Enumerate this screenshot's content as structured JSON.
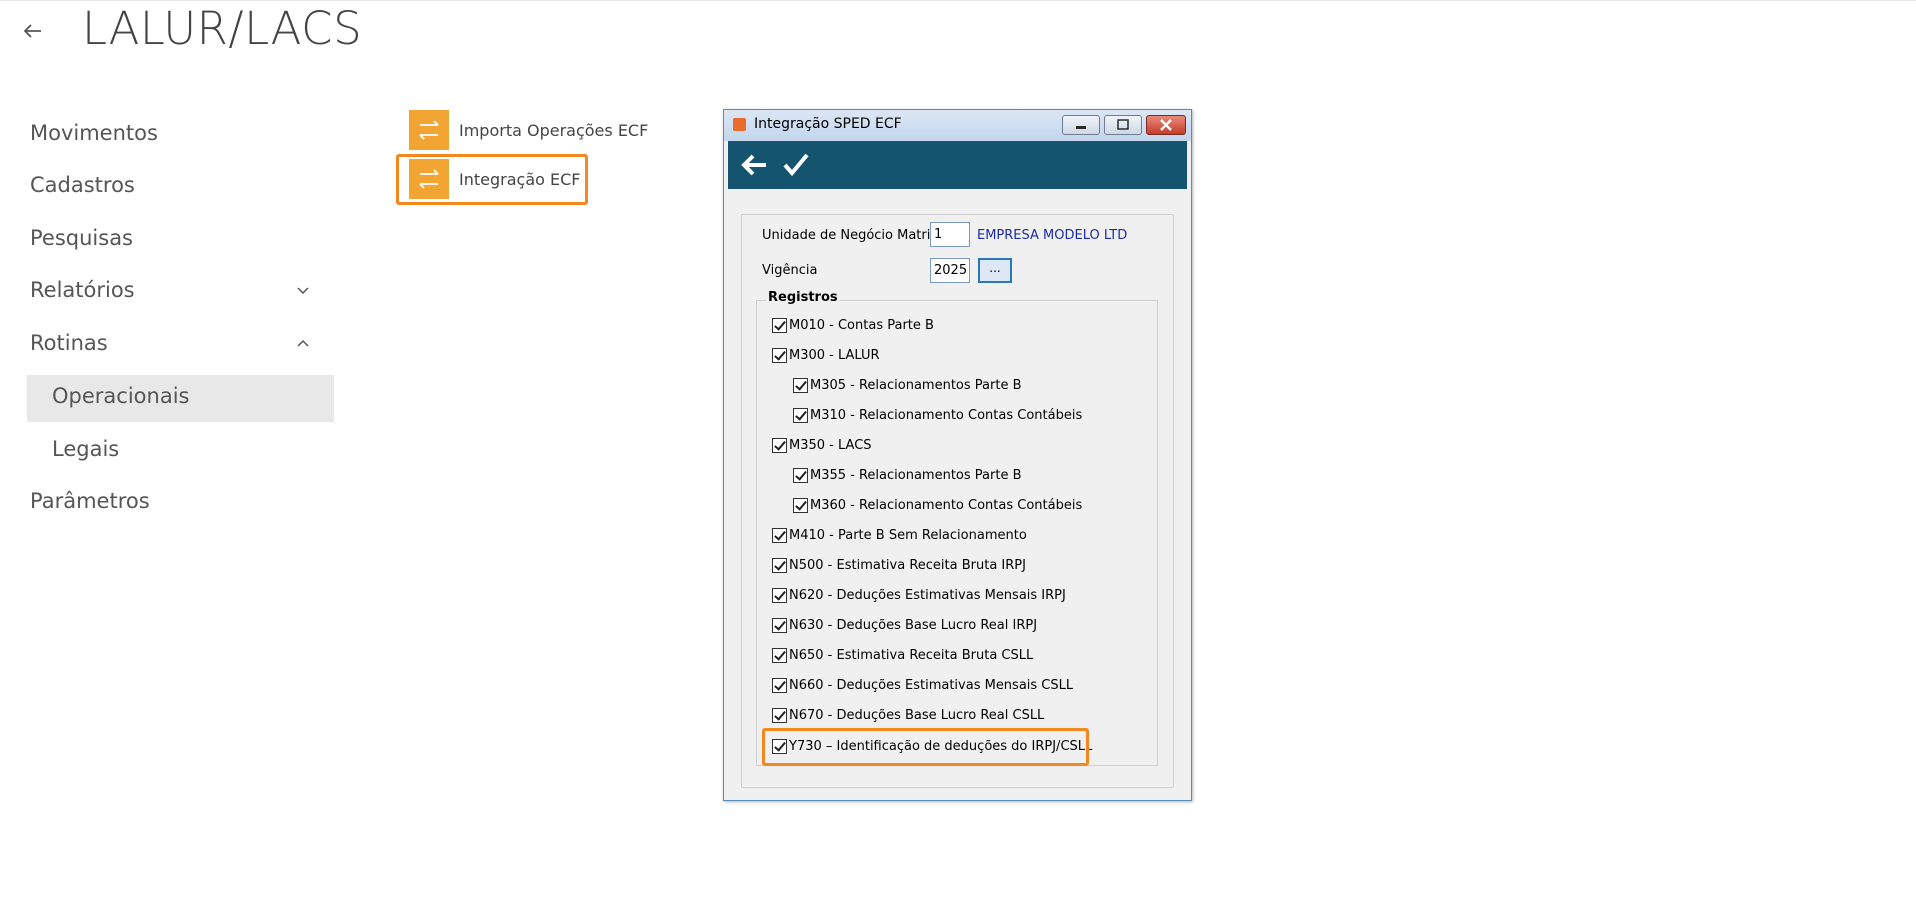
{
  "page": {
    "title": "LALUR/LACS"
  },
  "nav": {
    "items": [
      {
        "label": "Movimentos"
      },
      {
        "label": "Cadastros"
      },
      {
        "label": "Pesquisas"
      },
      {
        "label": "Relatórios",
        "expanded": false
      },
      {
        "label": "Rotinas",
        "expanded": true
      },
      {
        "label": "Parâmetros"
      }
    ],
    "subitems": [
      {
        "label": "Operacionais",
        "active": true
      },
      {
        "label": "Legais",
        "active": false
      }
    ]
  },
  "tiles": [
    {
      "label": "Importa Operações ECF",
      "icon": "swap-arrows-icon"
    },
    {
      "label": "Integração ECF",
      "icon": "swap-arrows-icon",
      "highlighted": true
    }
  ],
  "dialog": {
    "title": "Integração SPED ECF",
    "unidade_label": "Unidade de Negócio Matriz",
    "unidade_value": "1",
    "empresa": "EMPRESA MODELO LTD",
    "vigencia_label": "Vigência",
    "vigencia_value": "2025",
    "ellipsis": "...",
    "registros_label": "Registros",
    "registros": [
      {
        "label": "M010 - Contas Parte B",
        "checked": true
      },
      {
        "label": "M300 - LALUR",
        "checked": true
      },
      {
        "label": "M305 - Relacionamentos Parte B",
        "checked": true
      },
      {
        "label": "M310 - Relacionamento Contas Contábeis",
        "checked": true
      },
      {
        "label": "M350 - LACS",
        "checked": true
      },
      {
        "label": "M355 - Relacionamentos Parte B",
        "checked": true
      },
      {
        "label": "M360 - Relacionamento Contas Contábeis",
        "checked": true
      },
      {
        "label": "M410 - Parte B Sem Relacionamento",
        "checked": true
      },
      {
        "label": "N500 - Estimativa Receita Bruta IRPJ",
        "checked": true
      },
      {
        "label": "N620 - Deduções Estimativas Mensais IRPJ",
        "checked": true
      },
      {
        "label": "N630 - Deduções Base Lucro Real IRPJ",
        "checked": true
      },
      {
        "label": "N650 - Estimativa Receita Bruta CSLL",
        "checked": true
      },
      {
        "label": "N660 - Deduções Estimativas Mensais CSLL",
        "checked": true
      },
      {
        "label": "N670 - Deduções Base Lucro Real CSLL",
        "checked": true
      },
      {
        "label": "Y730 – Identificação de deduções do IRPJ/CSLL",
        "checked": true
      }
    ]
  },
  "colors": {
    "accent_orange": "#f5871f",
    "tile_orange": "#f3a533",
    "toolbar_blue": "#15546f"
  }
}
